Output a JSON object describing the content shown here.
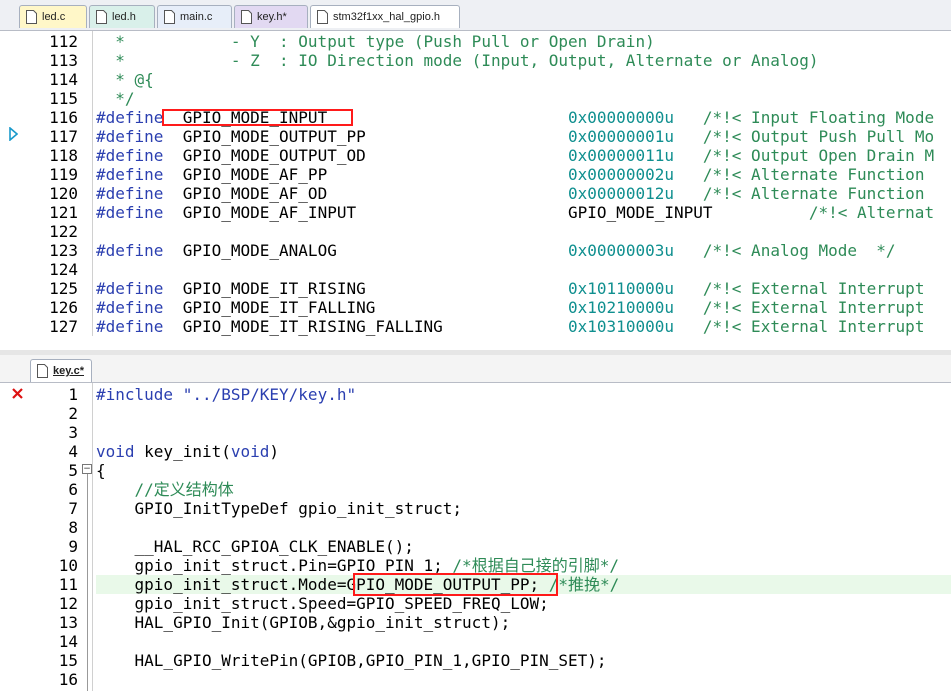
{
  "top_tabs": [
    {
      "label": "led.c"
    },
    {
      "label": "led.h"
    },
    {
      "label": "main.c"
    },
    {
      "label": "key.h*"
    },
    {
      "label": "stm32f1xx_hal_gpio.h"
    }
  ],
  "top_lines": [
    {
      "n": "112",
      "parts": [
        [
          "cm",
          "  *           - Y  : Output type (Push Pull or Open Drain)"
        ]
      ]
    },
    {
      "n": "113",
      "parts": [
        [
          "cm",
          "  *           - Z  : IO Direction mode (Input, Output, Alternate or Analog)"
        ]
      ]
    },
    {
      "n": "114",
      "parts": [
        [
          "cm",
          "  * @{"
        ]
      ]
    },
    {
      "n": "115",
      "parts": [
        [
          "cm",
          "  */"
        ]
      ]
    },
    {
      "n": "116",
      "parts": [
        [
          "pp",
          "#define"
        ],
        [
          "",
          "  GPIO_MODE_INPUT                         "
        ],
        [
          "num",
          "0x00000000u"
        ],
        [
          "",
          "   "
        ],
        [
          "cm",
          "/*!< Input Floating Mode"
        ]
      ]
    },
    {
      "n": "117",
      "parts": [
        [
          "pp",
          "#define"
        ],
        [
          "",
          "  GPIO_MODE_OUTPUT_PP                     "
        ],
        [
          "num",
          "0x00000001u"
        ],
        [
          "",
          "   "
        ],
        [
          "cm",
          "/*!< Output Push Pull Mo"
        ]
      ]
    },
    {
      "n": "118",
      "parts": [
        [
          "pp",
          "#define"
        ],
        [
          "",
          "  GPIO_MODE_OUTPUT_OD                     "
        ],
        [
          "num",
          "0x00000011u"
        ],
        [
          "",
          "   "
        ],
        [
          "cm",
          "/*!< Output Open Drain M"
        ]
      ]
    },
    {
      "n": "119",
      "parts": [
        [
          "pp",
          "#define"
        ],
        [
          "",
          "  GPIO_MODE_AF_PP                         "
        ],
        [
          "num",
          "0x00000002u"
        ],
        [
          "",
          "   "
        ],
        [
          "cm",
          "/*!< Alternate Function"
        ]
      ]
    },
    {
      "n": "120",
      "parts": [
        [
          "pp",
          "#define"
        ],
        [
          "",
          "  GPIO_MODE_AF_OD                         "
        ],
        [
          "num",
          "0x00000012u"
        ],
        [
          "",
          "   "
        ],
        [
          "cm",
          "/*!< Alternate Function"
        ]
      ]
    },
    {
      "n": "121",
      "parts": [
        [
          "pp",
          "#define"
        ],
        [
          "",
          "  GPIO_MODE_AF_INPUT                      GPIO_MODE_INPUT          "
        ],
        [
          "cm",
          "/*!< Alternat"
        ]
      ]
    },
    {
      "n": "122",
      "parts": []
    },
    {
      "n": "123",
      "parts": [
        [
          "pp",
          "#define"
        ],
        [
          "",
          "  GPIO_MODE_ANALOG                        "
        ],
        [
          "num",
          "0x00000003u"
        ],
        [
          "",
          "   "
        ],
        [
          "cm",
          "/*!< Analog Mode  */"
        ]
      ]
    },
    {
      "n": "124",
      "parts": []
    },
    {
      "n": "125",
      "parts": [
        [
          "pp",
          "#define"
        ],
        [
          "",
          "  GPIO_MODE_IT_RISING                     "
        ],
        [
          "num",
          "0x10110000u"
        ],
        [
          "",
          "   "
        ],
        [
          "cm",
          "/*!< External Interrupt"
        ]
      ]
    },
    {
      "n": "126",
      "parts": [
        [
          "pp",
          "#define"
        ],
        [
          "",
          "  GPIO_MODE_IT_FALLING                    "
        ],
        [
          "num",
          "0x10210000u"
        ],
        [
          "",
          "   "
        ],
        [
          "cm",
          "/*!< External Interrupt"
        ]
      ]
    },
    {
      "n": "127",
      "parts": [
        [
          "pp",
          "#define"
        ],
        [
          "",
          "  GPIO_MODE_IT_RISING_FALLING             "
        ],
        [
          "num",
          "0x10310000u"
        ],
        [
          "",
          "   "
        ],
        [
          "cm",
          "/*!< External Interrupt"
        ]
      ]
    }
  ],
  "bottom_tab": {
    "label": "key.c*"
  },
  "bottom_lines": [
    {
      "n": "1",
      "parts": [
        [
          "pp",
          "#include"
        ],
        [
          "",
          " "
        ],
        [
          "str",
          "\"../BSP/KEY/key.h\""
        ]
      ]
    },
    {
      "n": "2",
      "parts": []
    },
    {
      "n": "3",
      "parts": []
    },
    {
      "n": "4",
      "parts": [
        [
          "kw",
          "void"
        ],
        [
          "",
          " key_init("
        ],
        [
          "kw",
          "void"
        ],
        [
          "",
          ")"
        ]
      ]
    },
    {
      "n": "5",
      "parts": [
        [
          "",
          "{"
        ]
      ]
    },
    {
      "n": "6",
      "parts": [
        [
          "cm",
          "    //定义结构体"
        ]
      ]
    },
    {
      "n": "7",
      "parts": [
        [
          "",
          "    GPIO_InitTypeDef gpio_init_struct;"
        ]
      ]
    },
    {
      "n": "8",
      "parts": []
    },
    {
      "n": "9",
      "parts": [
        [
          "",
          "    __HAL_RCC_GPIOA_CLK_ENABLE();"
        ]
      ]
    },
    {
      "n": "10",
      "parts": [
        [
          "",
          "    gpio_init_struct.Pin=GPIO_PIN_1; "
        ],
        [
          "cm",
          "/*根据自己接的引脚*/"
        ]
      ]
    },
    {
      "n": "11",
      "parts": [
        [
          "",
          "    gpio_init_struct.Mode=GPIO_MODE_OUTPUT_PP; "
        ],
        [
          "cm",
          "/*推挽*/"
        ]
      ]
    },
    {
      "n": "12",
      "parts": [
        [
          "",
          "    gpio_init_struct.Speed=GPIO_SPEED_FREQ_LOW;"
        ]
      ]
    },
    {
      "n": "13",
      "parts": [
        [
          "",
          "    HAL_GPIO_Init(GPIOB,&gpio_init_struct);"
        ]
      ]
    },
    {
      "n": "14",
      "parts": []
    },
    {
      "n": "15",
      "parts": [
        [
          "",
          "    HAL_GPIO_WritePin(GPIOB,GPIO_PIN_1,GPIO_PIN_SET);"
        ]
      ]
    },
    {
      "n": "16",
      "parts": []
    }
  ],
  "colors": {
    "comment": "#2e8b57",
    "keyword": "#2b3fb0",
    "number": "#0f8f8f",
    "highlight_box": "#ff1a1a",
    "current_line": "#e9f9e9"
  }
}
